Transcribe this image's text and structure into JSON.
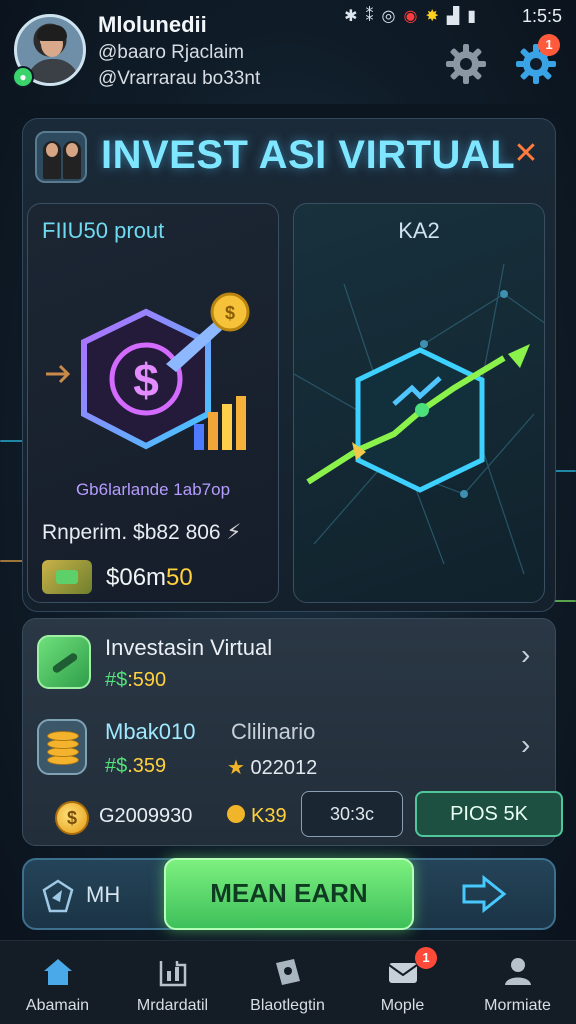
{
  "status_bar": {
    "time": "1:5:5",
    "icons": [
      "bluetooth-icon",
      "vibrate-icon",
      "alarm-icon",
      "record-icon",
      "notification-icon",
      "signal-icon",
      "battery-icon"
    ]
  },
  "profile": {
    "name": "Mlolunedii",
    "line1": "@baaro Rjaclaim",
    "line2": "@Vrarrarau bo33nt"
  },
  "header": {
    "settings_badge": "1"
  },
  "card": {
    "title_part1": "INVEST ",
    "title_part2": "ASI VIRTUAL",
    "left_panel": {
      "title": "FIIU50 prout",
      "caption": "Gb6larlande 1ab7op",
      "profit_line": "Rnperim. $b82 806",
      "cash_value_main": "$06m",
      "cash_value_hl": "50"
    },
    "right_panel": {
      "title": "KA2"
    }
  },
  "list": {
    "row1": {
      "title": "Investasin Virtual",
      "value_prefix": "#$",
      "value": ":590"
    },
    "row2": {
      "title": "Mbak010",
      "subtitle": "Clilinario",
      "value_prefix": "#$",
      "value": ".359",
      "stat_value": "022012"
    },
    "footer": {
      "coin_value": "G2009930",
      "small_coin_value": "K39",
      "input_value": "30:3c",
      "button_label": "PIOS 5K"
    }
  },
  "action_bar": {
    "left_label": "MH",
    "earn_button": "MEAN EARN"
  },
  "nav": {
    "items": [
      {
        "label": "Abamain"
      },
      {
        "label": "Mrdardatil"
      },
      {
        "label": "Blaotlegtin"
      },
      {
        "label": "Mople",
        "badge": "1"
      },
      {
        "label": "Mormiate"
      }
    ]
  },
  "colors": {
    "accent_cyan": "#7fe6ff",
    "accent_green": "#53e07a",
    "accent_gold": "#ffd13d",
    "earn_button": "#5cd86a",
    "badge_red": "#ff4a3a"
  }
}
